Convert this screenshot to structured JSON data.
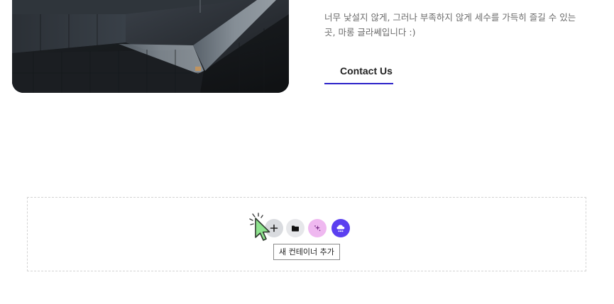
{
  "content": {
    "description_lines": [
      "너무 낯설지 않게, 그러나 부족하지 않게 세수를 가득히 즐길 수 있는",
      "곳, 마롱 글라쎄입니다 :)"
    ],
    "contact_label": "Contact Us"
  },
  "builder": {
    "tooltip": "새 컨테이너 추가",
    "buttons": [
      {
        "name": "add-container",
        "icon": "plus-icon",
        "color": "#d9dbdf"
      },
      {
        "name": "add-template",
        "icon": "folder-icon",
        "color": "#e6e7ea"
      },
      {
        "name": "ai-generate",
        "icon": "sparkle-icon",
        "color": "#efb8f0"
      },
      {
        "name": "cloud-library",
        "icon": "cloud-icon",
        "color": "#5b3ff0"
      }
    ]
  },
  "colors": {
    "accent": "#2b22c9",
    "cloud_button": "#5b3ff0",
    "ai_button": "#efb8f0",
    "cursor_fill": "#8ee38e"
  }
}
